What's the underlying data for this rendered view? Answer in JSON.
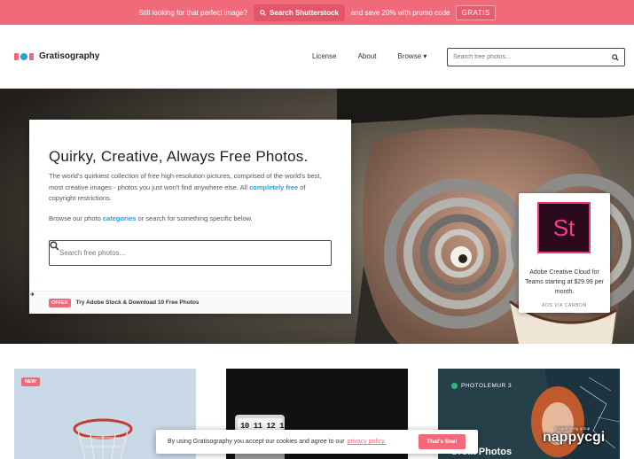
{
  "promo": {
    "lead_text": "Still looking for that perfect image?",
    "button_label": "Search Shutterstock",
    "trail_text": "and save 20% with promo code",
    "code": "GRATIS"
  },
  "nav": {
    "logo_text": "Gratisography",
    "links": [
      "License",
      "About",
      "Browse ▾"
    ],
    "search_placeholder": "Search free photos..."
  },
  "hero": {
    "title": "Quirky, Creative, Always Free Photos.",
    "desc_part1": "The world's quirkiest collection of free high-resolution pictures, comprised of the world's best, most creative images - photos you just won't find anywhere else. All",
    "desc_link": "completely free",
    "desc_part2": "of copyright restrictions.",
    "browse_part1": "Browse our photo",
    "browse_link": "categories",
    "browse_part2": "or search for something specific below.",
    "search_placeholder": "Search free photos...",
    "offer_badge": "OFFER",
    "offer_text": "Try Adobe Stock & Download 10 Free Photos"
  },
  "ad": {
    "logo_text": "St",
    "text": "Adobe Creative Cloud for Teams starting at $29.99 per month.",
    "via": "ADS VIA CARBON"
  },
  "gallery": {
    "new_badge": "NEW",
    "clock_digits": "10 11 12 1",
    "ad_brand": "PHOTOLEMUR 3",
    "ad_headline": "Great Photos"
  },
  "cookie": {
    "text": "By using Gratisography you accept our cookies and agree to our",
    "policy_link": "privacy policy.",
    "button": "That's fine!"
  },
  "watermark": {
    "small": "programming group",
    "big": "nappycgi"
  },
  "colors": {
    "accent": "#f16a7a",
    "link": "#2a9fd8"
  }
}
